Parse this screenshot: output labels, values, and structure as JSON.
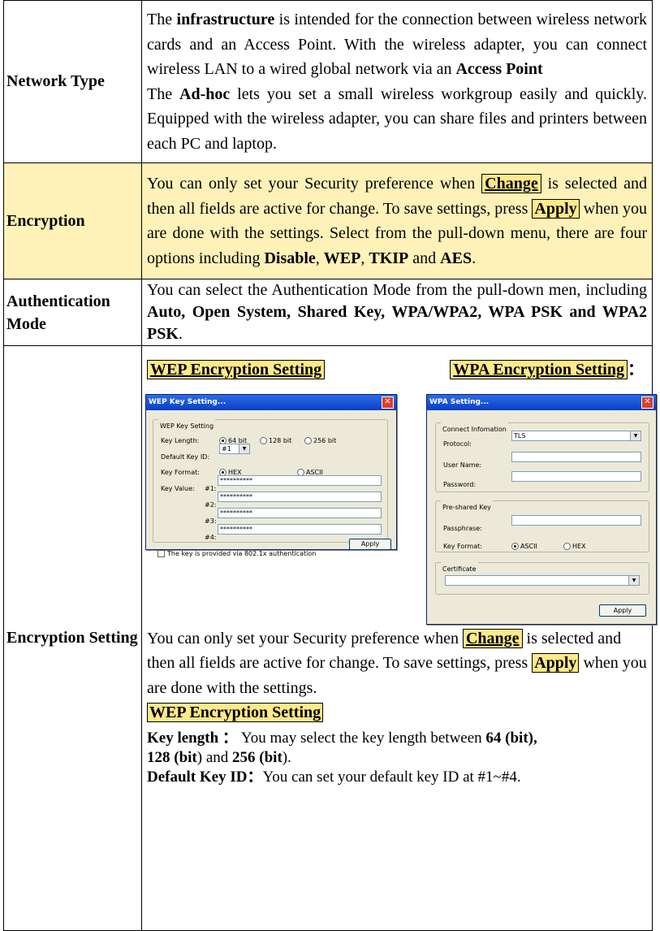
{
  "rows": {
    "network_type": {
      "label": "Network Type",
      "p1_a": "The ",
      "p1_b": "infrastructure",
      "p1_c": " is intended for the connection between wireless network cards and an Access Point. With the wireless adapter, you can connect wireless LAN to a wired global network via an ",
      "p1_d": "Access Point",
      "p2_a": "The ",
      "p2_b": "Ad-hoc",
      "p2_c": " lets you set a small wireless workgroup easily and quickly.   Equipped with the wireless adapter, you can share files and printers between each PC and laptop."
    },
    "encryption": {
      "label": "Encryption",
      "t1": "You can only set your Security preference when ",
      "change": "Change",
      "t2": " is selected and then all fields are active for change. To save settings, press ",
      "apply": "Apply",
      "t3": " when you are done with the settings. Select from the pull-down menu, there are four options including ",
      "o1": "Disable",
      "sep1": ", ",
      "o2": "WEP",
      "sep2": ", ",
      "o3": "TKIP",
      "and": " and ",
      "o4": "AES",
      "end": "."
    },
    "auth": {
      "label": "Authentication Mode",
      "t1": "You can select the Authentication Mode from the pull-down men, including ",
      "modes": "Auto, Open System, Shared Key, WPA/WPA2, WPA PSK and WPA2 PSK",
      "end": "."
    },
    "enc_setting": {
      "label": "Encryption Setting",
      "wep_head": "WEP Encryption Setting",
      "wpa_head": "WPA Encryption Setting",
      "wpa_colon": "：",
      "after_t1": "You can only set your Security preference when ",
      "after_change": "Change",
      "after_t2": " is selected and then all fields are active for change. To save settings, press ",
      "after_apply": "Apply",
      "after_t3": " when you are done with the settings.",
      "wep_sub": "WEP Encryption Setting",
      "kl_label": "Key length ：",
      "kl_t1": " You may select the key length between ",
      "kl_64": "64 (bit),",
      "kl_128": "128 (bit",
      "kl_t2": ") and ",
      "kl_256": "256 (bit",
      "kl_t3": ").",
      "dk_label": "Default Key ID：",
      "dk_text": "You can set your default key ID at #1~#4."
    }
  },
  "wep_dialog": {
    "title": "WEP Key Setting...",
    "group": "WEP Key Setting",
    "key_length_label": "Key Length:",
    "opt64": "64 bit",
    "opt128": "128 bit",
    "opt256": "256 bit",
    "default_key_label": "Default Key ID:",
    "default_key_value": "#1",
    "key_format_label": "Key Format:",
    "hex": "HEX",
    "ascii": "ASCII",
    "key_value_label": "Key Value:",
    "k1": "#1:",
    "k2": "#2:",
    "k3": "#3:",
    "k4": "#4:",
    "masked": "**********",
    "checkbox_label": "The key is provided via 802.1x authentication",
    "apply": "Apply"
  },
  "wpa_dialog": {
    "title": "WPA Setting...",
    "group1": "Connect Infomation",
    "protocol_label": "Protocol:",
    "protocol_value": "TLS",
    "user_label": "User Name:",
    "password_label": "Password:",
    "group2": "Pre-shared Key",
    "pass_label": "Passphrase:",
    "format_label": "Key Format:",
    "ascii": "ASCII",
    "hex": "HEX",
    "group3": "Certificate",
    "apply": "Apply"
  },
  "colors": {
    "highlight": "#ffe98a",
    "shade": "#fff2b8",
    "title_blue": "#0a3fc4"
  }
}
